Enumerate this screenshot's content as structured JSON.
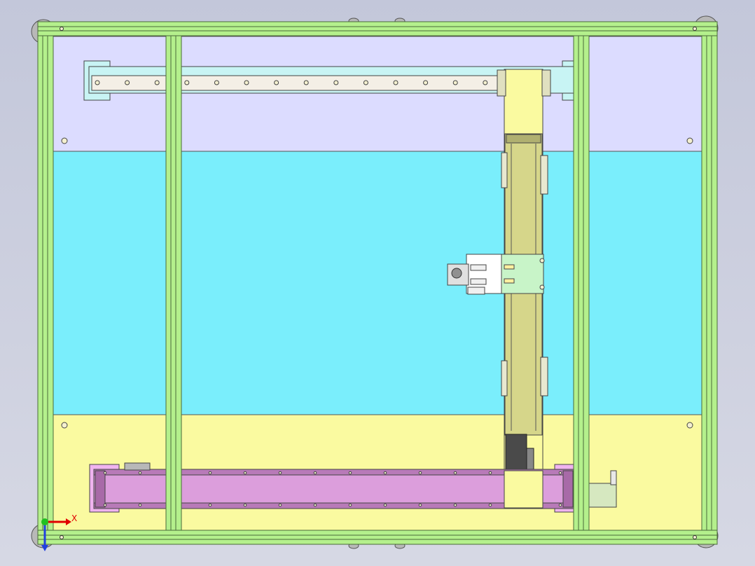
{
  "viewport": {
    "title": "",
    "background_color": "#c8cbdc"
  },
  "colors": {
    "frame_green": "#b4f08c",
    "frame_edge": "#4a6a3a",
    "panel_lavender": "#dcdcff",
    "panel_cyan": "#7aeefc",
    "panel_yellow": "#fafaa0",
    "rail_light": "#f4efe6",
    "rail_mount_cyan": "#c8f4f4",
    "carriage_yellow": "#fafaa0",
    "axis_body": "#d6d68a",
    "belt_axis_pink": "#dc9edc",
    "mount_pink": "#f0b4f0",
    "carriage_mint": "#c8f4c8",
    "motor_dark": "#4a4a4a",
    "axis_x": "#e00000",
    "axis_y": "#20c020",
    "axis_z": "#2040e0"
  },
  "triad": {
    "x_label": "X"
  },
  "icons": [
    "coordinate-triad-icon",
    "mounting-hole-icon",
    "corner-foot-icon"
  ]
}
